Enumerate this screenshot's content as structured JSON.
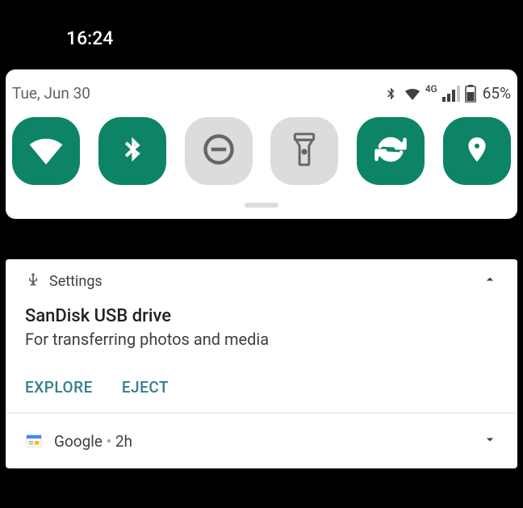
{
  "statusbar": {
    "time": "16:24"
  },
  "qs_panel": {
    "date": "Tue, Jun 30",
    "battery_text": "65%",
    "signal_label": "4G",
    "tiles": [
      {
        "name": "wifi",
        "on": true
      },
      {
        "name": "bluetooth",
        "on": true
      },
      {
        "name": "dnd",
        "on": false
      },
      {
        "name": "flashlight",
        "on": false
      },
      {
        "name": "autorotate",
        "on": true
      },
      {
        "name": "location",
        "on": true
      }
    ]
  },
  "notifications": {
    "usb": {
      "app": "Settings",
      "title": "SanDisk USB drive",
      "body": "For transferring photos and media",
      "action_explore": "EXPLORE",
      "action_eject": "EJECT"
    },
    "google": {
      "app": "Google",
      "sep": " • ",
      "age": "2h"
    }
  }
}
